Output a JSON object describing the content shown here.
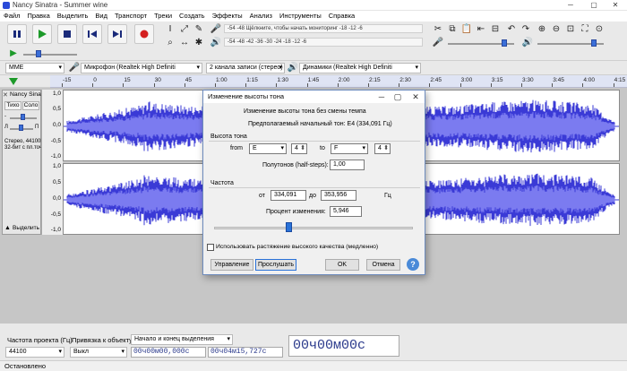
{
  "window": {
    "title": "Nancy Sinatra - Summer wine",
    "minimize": "─",
    "maximize": "▢",
    "close": "✕"
  },
  "menu": [
    "Файл",
    "Правка",
    "Выделить",
    "Вид",
    "Транспорт",
    "Треки",
    "Создать",
    "Эффекты",
    "Анализ",
    "Инструменты",
    "Справка"
  ],
  "meters": {
    "record_scale": "-54  -48  Щёлкните, чтобы начать мониторинг  -18  -12   -6",
    "play_scale": "-54  -48  -42  -36  -30  -24  -18  -12   -6"
  },
  "devices": {
    "host": "MME",
    "mic": "Микрофон (Realtek High Definiti",
    "channels": "2 канала записи (стерео)",
    "speakers": "Динамики (Realtek High Definiti"
  },
  "ruler": [
    "-15",
    "0",
    "15",
    "30",
    "45",
    "1:00",
    "1:15",
    "1:30",
    "1:45",
    "2:00",
    "2:15",
    "2:30",
    "2:45",
    "3:00",
    "3:15",
    "3:30",
    "3:45",
    "4:00",
    "4:15"
  ],
  "track": {
    "name": "Nancy Sinatr",
    "mute": "Тихо",
    "solo": "Соло",
    "gain_l": "Л",
    "gain_r": "П",
    "info1": "Стерео, 44100Гц",
    "info2": "32-бит с пл.точ.",
    "select": "Выделить",
    "scale": [
      "1,0",
      "0,5",
      "0,0",
      "-0,5",
      "-1,0",
      "1,0",
      "0,5",
      "0,0",
      "-0,5",
      "-1,0"
    ]
  },
  "dialog": {
    "title": "Изменение высоты тона",
    "header": "Изменение высоты тона без смены темпа",
    "estimated": "Предполагаемый начальный тон: E4 (334,091 Гц)",
    "pitch_section": "Высота тона",
    "from_label": "from",
    "from_note": "E",
    "from_oct": "4",
    "to_label": "to",
    "to_note": "F",
    "to_oct": "4",
    "semitones_label": "Полутонов (half-steps):",
    "semitones_value": "1,00",
    "freq_section": "Частота",
    "freq_from_label": "от",
    "freq_from": "334,091",
    "freq_to_label": "до",
    "freq_to": "353,956",
    "freq_unit": "Гц",
    "percent_label": "Процент изменения:",
    "percent_value": "5,946",
    "slider_value_percent": 5.946,
    "hq_label": "Использовать растяжение высокого качества (медленно)",
    "manage": "Управление",
    "preview": "Прослушать",
    "ok": "OK",
    "cancel": "Отмена",
    "help": "?"
  },
  "bottom": {
    "rate_label": "Частота проекта (Гц)",
    "rate_value": "44100",
    "snap_label": "Привязка к объекту",
    "snap_value": "Выкл",
    "sel_label": "Начало и конец выделения",
    "sel_start": "00ч00м00,000с",
    "sel_end": "00ч04м15,727с",
    "big_time": "00ч00м00с"
  },
  "status": "Остановлено",
  "colors": {
    "wave": "#3a3ad6",
    "wave_light": "#7b7bf0",
    "ruler_bg": "#dfe4f4"
  }
}
